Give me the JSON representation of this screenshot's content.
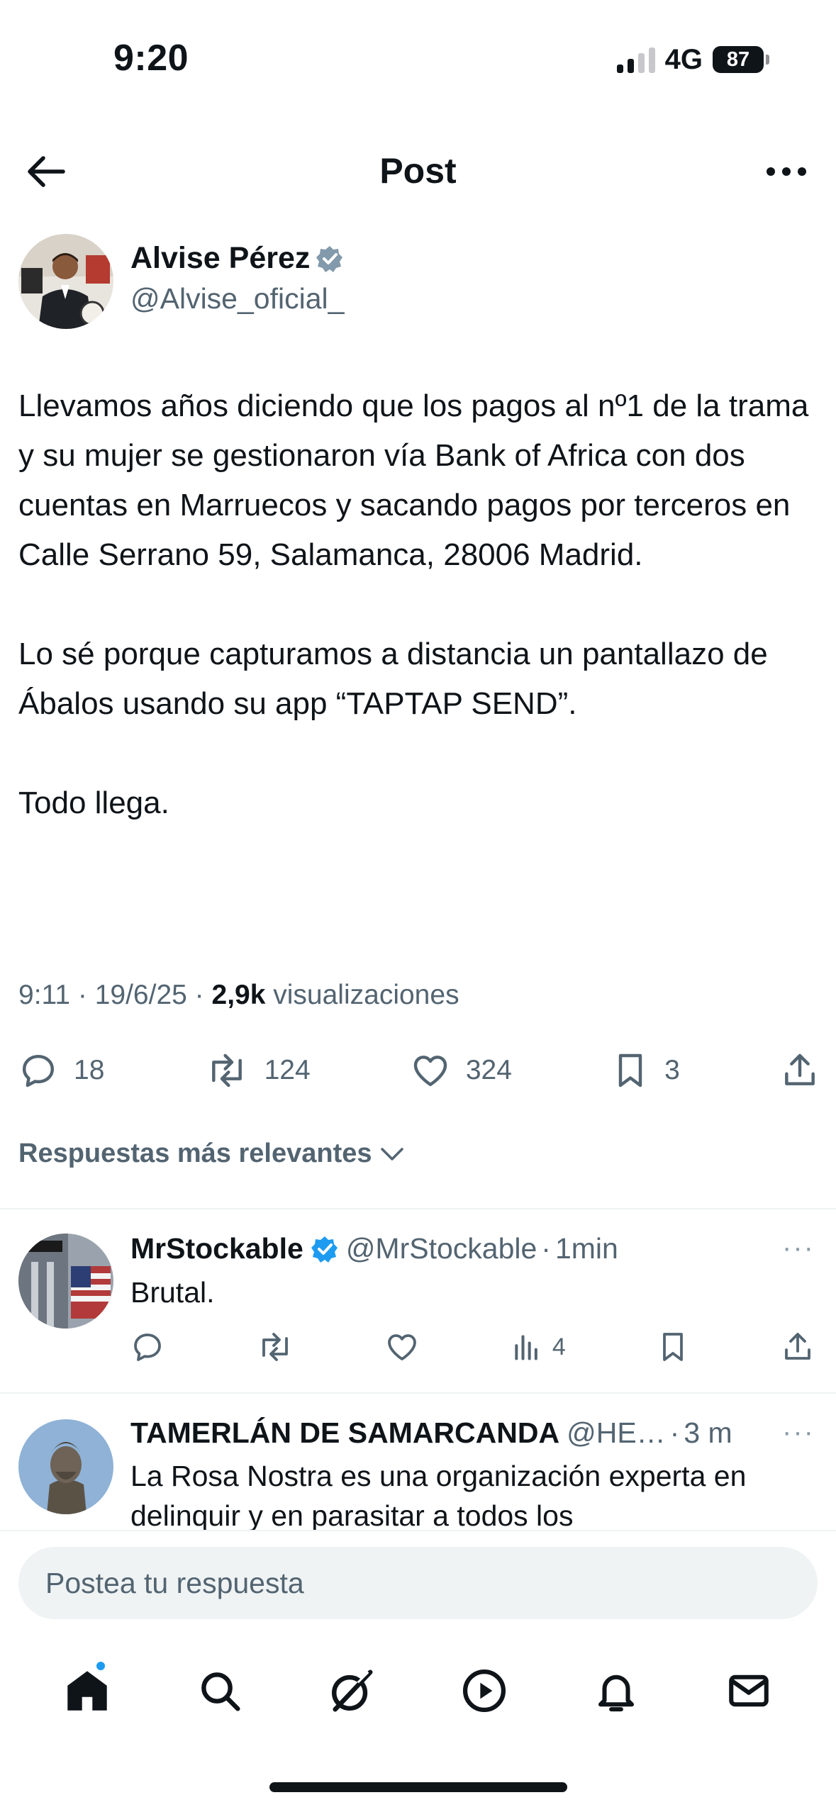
{
  "status_bar": {
    "time": "9:20",
    "network": "4G",
    "battery": "87"
  },
  "header": {
    "title": "Post",
    "back_icon": "arrow-left-icon",
    "more_icon": "more-horizontal-icon"
  },
  "post": {
    "author": {
      "name": "Alvise Pérez",
      "handle": "@Alvise_oficial_",
      "verified": true
    },
    "text": {
      "p1": "Llevamos años diciendo que los pagos al nº1 de la trama y su mujer se gestionaron vía Bank of Africa con dos cuentas en Marruecos y sacando pagos por terceros en Calle Serrano 59, Salamanca, 28006 Madrid.",
      "p2": "Lo sé porque capturamos a distancia un pantallazo de Ábalos usando su app “TAPTAP SEND”.",
      "p3": "Todo llega."
    },
    "meta": {
      "time": "9:11",
      "date": "19/6/25",
      "views": "2,9k",
      "views_label": "visualizaciones",
      "separator": "·"
    },
    "stats": {
      "replies": "18",
      "reposts": "124",
      "likes": "324",
      "bookmarks": "3"
    }
  },
  "relevance_filter": {
    "label": "Respuestas más relevantes"
  },
  "replies": [
    {
      "name": "MrStockable",
      "handle": "@MrStockable",
      "dot": "·",
      "time": "1min",
      "verified": true,
      "text": "Brutal.",
      "views": "4",
      "more": "···"
    },
    {
      "name": "TAMERLÁN DE SAMARCANDA",
      "handle": "@HE…",
      "dot": "·",
      "time": "3 m",
      "verified": false,
      "text": "La Rosa Nostra es una organización experta en delinquir y en parasitar a todos los",
      "more": "···"
    }
  ],
  "compose": {
    "placeholder": "Postea tu respuesta"
  },
  "bottom_nav": [
    "home-icon",
    "search-icon",
    "grok-icon",
    "video-icon",
    "notifications-icon",
    "messages-icon"
  ],
  "colors": {
    "verified_gray": "#829aab",
    "verified_blue": "#1d9bf0",
    "text_primary": "#0f1419",
    "text_secondary": "#536471",
    "accent": "#1d9bf0"
  }
}
